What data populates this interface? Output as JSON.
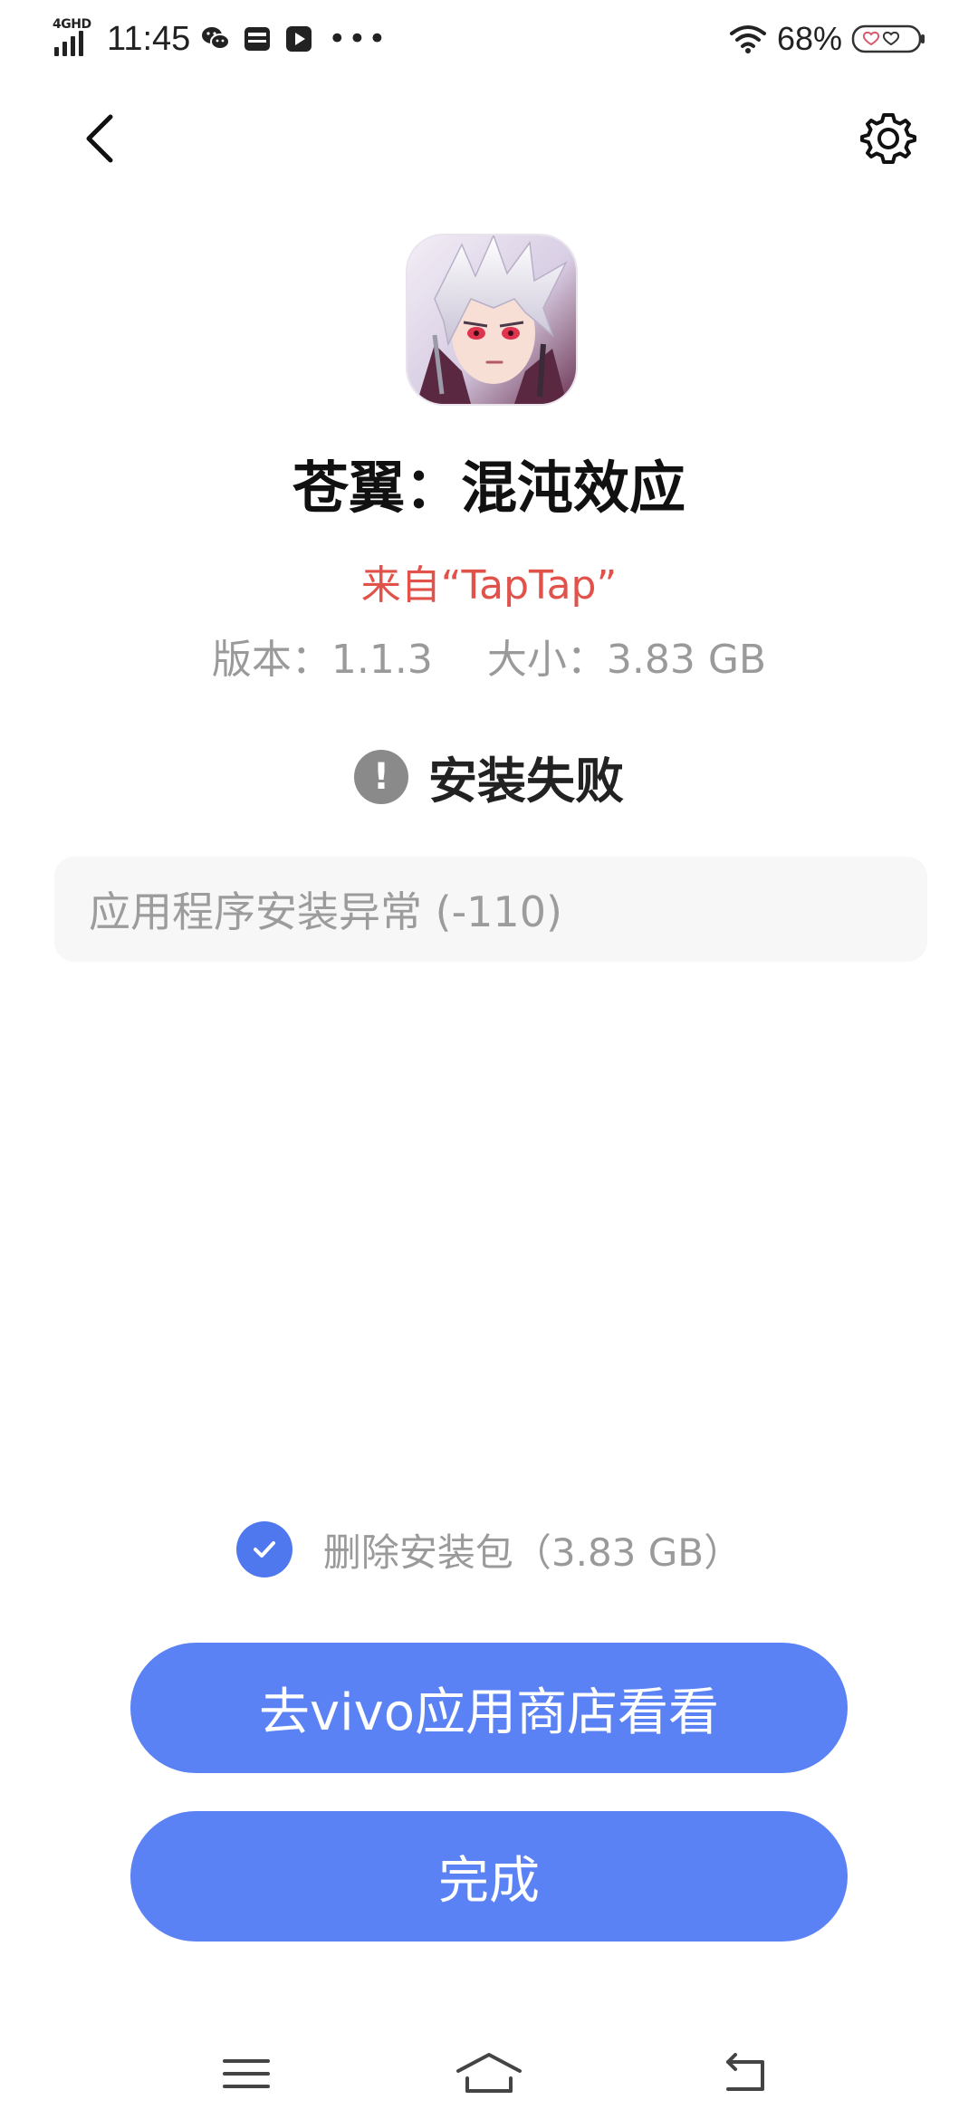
{
  "status_bar": {
    "network": "4GHD",
    "time": "11:45",
    "battery": "68%"
  },
  "app": {
    "name": "苍翼：混沌效应",
    "source": "来自“TapTap”",
    "version_label": "版本：1.1.3",
    "size_label": "大小：3.83 GB"
  },
  "install": {
    "status_text": "安装失败",
    "error_message": "应用程序安装异常 (-110)"
  },
  "options": {
    "delete_package_label": "删除安装包（3.83 GB）",
    "delete_package_checked": true
  },
  "actions": {
    "store_button": "去vivo应用商店看看",
    "done_button": "完成"
  },
  "colors": {
    "accent": "#5b82f5",
    "source_red": "#e0524a",
    "muted": "#9a9a9a"
  },
  "icons": {
    "header_left": "back-arrow-icon",
    "header_right": "gear-icon",
    "status": "exclamation-icon",
    "nav": [
      "menu-icon",
      "home-icon",
      "back-icon"
    ]
  }
}
